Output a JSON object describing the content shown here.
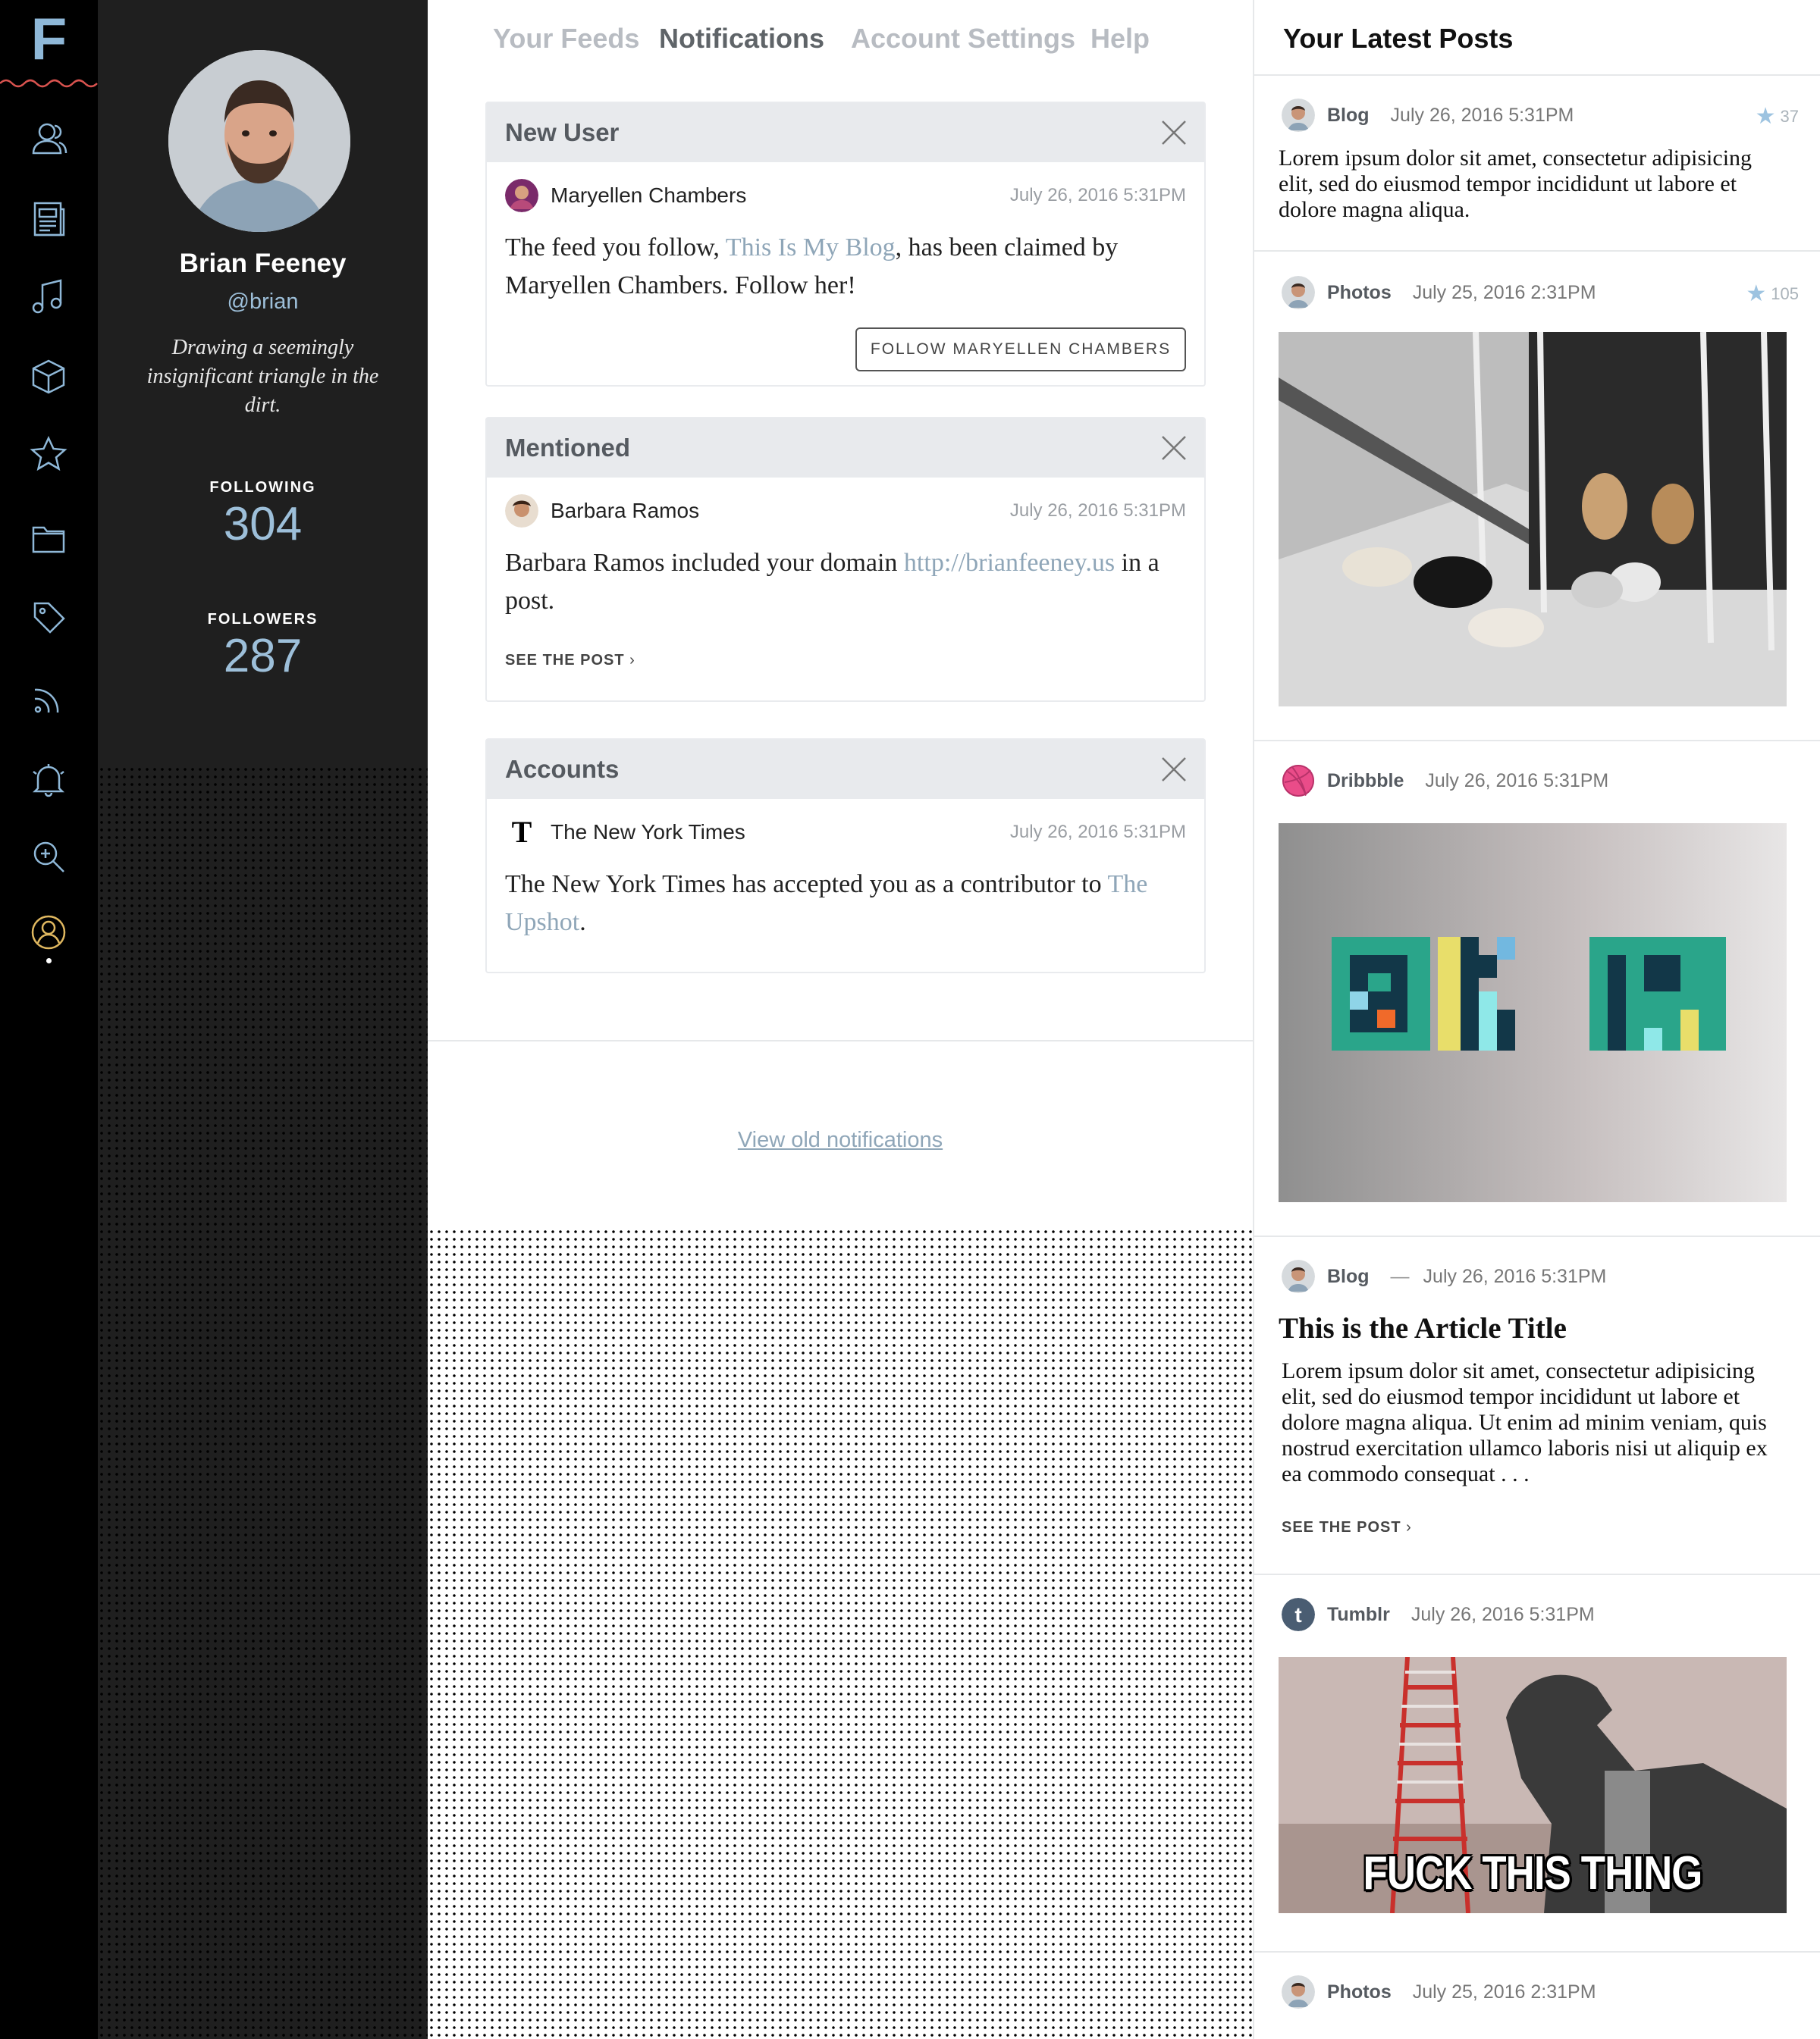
{
  "app": {
    "logo_letter": "F"
  },
  "rail": {
    "icons": [
      "users-icon",
      "news-icon",
      "music-icon",
      "box-icon",
      "star-icon",
      "folder-icon",
      "tag-icon",
      "rss-icon",
      "bell-icon",
      "search-zoom-icon",
      "profile-icon"
    ]
  },
  "profile": {
    "name": "Brian Feeney",
    "handle": "@brian",
    "bio": "Drawing a seemingly insignificant triangle in the dirt.",
    "following_label": "FOLLOWING",
    "following_count": "304",
    "followers_label": "FOLLOWERS",
    "followers_count": "287"
  },
  "tabs": [
    "Your Feeds",
    "Notifications",
    "Account Settings",
    "Help"
  ],
  "notifications": [
    {
      "heading": "New User",
      "user": "Maryellen Chambers",
      "date": "July 26, 2016 5:31PM",
      "text_before": "The feed you follow, ",
      "link": "This Is My Blog",
      "text_after": ", has been claimed by Maryellen Chambers. Follow her!",
      "button": "FOLLOW MARYELLEN CHAMBERS"
    },
    {
      "heading": "Mentioned",
      "user": "Barbara Ramos",
      "date": "July 26, 2016 5:31PM",
      "text_before": "Barbara Ramos included your domain ",
      "link": "http://brianfeeney.us",
      "text_after": " in a post.",
      "action": "SEE THE POST"
    },
    {
      "heading": "Accounts",
      "user": "The New York Times",
      "date": "July 26, 2016 5:31PM",
      "text_before": "The New York Times has accepted you as a contributor to ",
      "link": "The Upshot",
      "text_after": "."
    }
  ],
  "old_notifications_link": "View old notifications",
  "latest": {
    "title": "Your Latest Posts",
    "posts": [
      {
        "source": "Blog",
        "date": "July 26, 2016 5:31PM",
        "stars": "37",
        "text": "Lorem ipsum dolor sit amet, consectetur adipisicing elit, sed do eiusmod tempor incididunt ut labore et dolore magna aliqua."
      },
      {
        "source": "Photos",
        "date": "July 25, 2016 2:31PM",
        "stars": "105"
      },
      {
        "source": "Dribbble",
        "date": "July 26, 2016 5:31PM"
      },
      {
        "source": "Blog",
        "date": "July 26, 2016 5:31PM",
        "dash": "—",
        "title": "This is the Article Title",
        "text": "Lorem ipsum dolor sit amet, consectetur adipisicing elit, sed do eiusmod tempor incididunt ut labore et dolore magna aliqua. Ut enim ad minim veniam, quis nostrud exercitation ullamco laboris nisi ut aliquip ex ea commodo consequat . . .",
        "action": "SEE THE POST"
      },
      {
        "source": "Tumblr",
        "date": "July 26, 2016 5:31PM",
        "caption": "FUCK THIS THING"
      },
      {
        "source": "Photos",
        "date": "July 25, 2016 2:31PM"
      }
    ]
  },
  "colors": {
    "accent": "#8fa6b8",
    "logo": "#8fb8d8",
    "rail_bg": "#000000",
    "profile_bg": "#1f1f1f",
    "wave": "#d9534f"
  }
}
